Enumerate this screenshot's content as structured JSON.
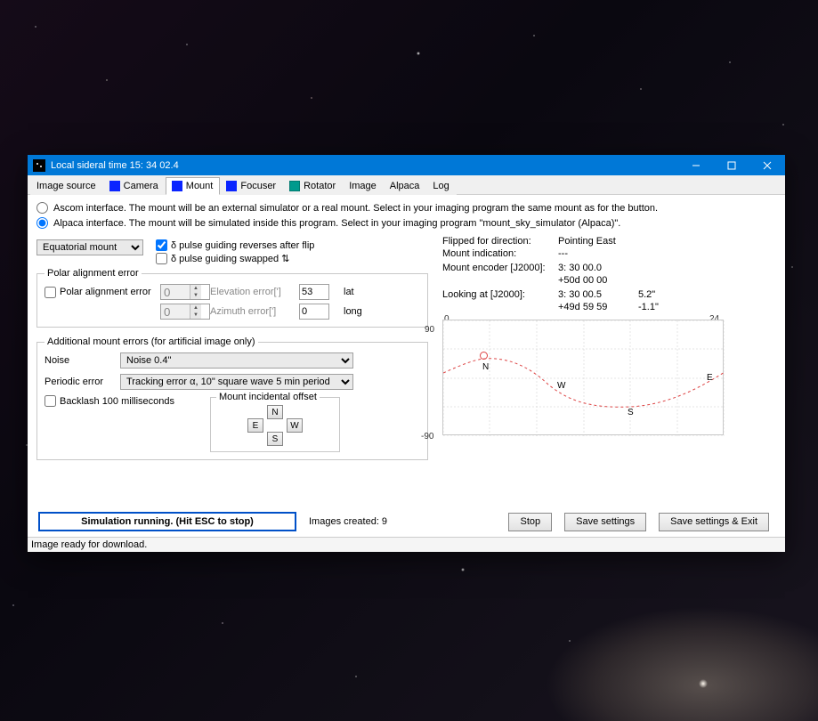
{
  "window": {
    "title": "Local sideral time 15: 34 02.4"
  },
  "tabs": {
    "items": [
      "Image source",
      "Camera",
      "Mount",
      "Focuser",
      "Rotator",
      "Image",
      "Alpaca",
      "Log"
    ],
    "active_index": 2
  },
  "interface": {
    "ascom_label": "Ascom interface. The mount will be an external simulator or a real mount. Select in your imaging program the same mount as for the button.",
    "alpaca_label": "Alpaca interface. The mount will be simulated inside this program.  Select in your imaging program \"mount_sky_simulator (Alpaca)\".",
    "selected": "alpaca"
  },
  "mount_type": {
    "selected": "Equatorial mount"
  },
  "pulse": {
    "reverses_label": "δ pulse guiding reverses after flip",
    "reverses_checked": true,
    "swapped_label": "δ  pulse guiding swapped ⇅",
    "swapped_checked": false
  },
  "polar": {
    "legend": "Polar alignment error",
    "chk_label": "Polar alignment error",
    "chk_checked": false,
    "spin1": "0",
    "elev_label": "Elevation error[']",
    "spin2": "0",
    "az_label": "Azimuth error[']",
    "lat_val": "53",
    "lat_label": "lat",
    "long_val": "0",
    "long_label": "long"
  },
  "errors": {
    "legend": "Additional mount errors (for artificial image only)",
    "noise_label": "Noise",
    "noise_value": "Noise 0.4\"",
    "periodic_label": "Periodic error",
    "periodic_value": "Tracking error α, 10\" square wave 5 min period",
    "backlash_label": "Backlash 100 milliseconds",
    "backlash_checked": false,
    "offset_legend": "Mount incidental offset",
    "dpad": {
      "n": "N",
      "s": "S",
      "e": "E",
      "w": "W"
    }
  },
  "status": {
    "rows": [
      [
        "Flipped for direction:",
        "Pointing East",
        ""
      ],
      [
        "Mount  indication:",
        "---",
        ""
      ],
      [
        "",
        "",
        ""
      ],
      [
        "Mount encoder [J2000]:",
        "3: 30 00.0",
        ""
      ],
      [
        "",
        "+50d 00 00",
        ""
      ],
      [
        "",
        "",
        ""
      ],
      [
        "Looking at [J2000]:",
        "3: 30 00.5",
        "5.2\""
      ],
      [
        "",
        "+49d 59 59",
        "-1.1\""
      ]
    ]
  },
  "chart_data": {
    "type": "line",
    "title": "",
    "xlabel": "",
    "ylabel": "",
    "xlim": [
      0,
      24
    ],
    "ylim": [
      -90,
      90
    ],
    "ticks_y": [
      -90,
      90
    ],
    "ticks_x": [
      0,
      24
    ],
    "series": [
      {
        "name": "horizon-path",
        "style": "dashed-red",
        "points": [
          [
            0,
            8
          ],
          [
            3,
            25
          ],
          [
            6,
            30
          ],
          [
            9,
            10
          ],
          [
            12,
            -18
          ],
          [
            15,
            -38
          ],
          [
            18,
            -40
          ],
          [
            21,
            -18
          ],
          [
            24,
            10
          ]
        ]
      }
    ],
    "cardinals": [
      {
        "label": "N",
        "x": 3.5,
        "y": 20
      },
      {
        "label": "W",
        "x": 10,
        "y": -8
      },
      {
        "label": "S",
        "x": 16,
        "y": -45
      },
      {
        "label": "E",
        "x": 23,
        "y": -4
      }
    ],
    "marker": {
      "x": 3.5,
      "y": 30
    }
  },
  "bottom": {
    "sim_label": "Simulation running. (Hit ESC to stop)",
    "images_created_label": "Images created: 9",
    "stop": "Stop",
    "save": "Save settings",
    "save_exit": "Save settings & Exit"
  },
  "statusbar": "Image ready for download."
}
